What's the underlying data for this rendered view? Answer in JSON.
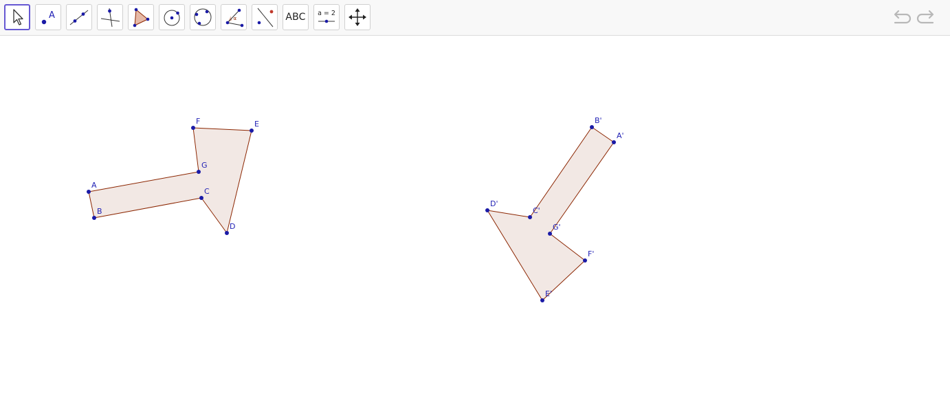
{
  "toolbar": {
    "tools": [
      {
        "id": "move",
        "icon": "arrow-pointer-icon",
        "active": true
      },
      {
        "id": "point",
        "icon": "point-icon",
        "label": "A"
      },
      {
        "id": "line",
        "icon": "line-through-points-icon"
      },
      {
        "id": "perpendicular",
        "icon": "perpendicular-line-icon"
      },
      {
        "id": "polygon",
        "icon": "polygon-icon"
      },
      {
        "id": "circle-center-point",
        "icon": "circle-center-point-icon"
      },
      {
        "id": "circle-three-points",
        "icon": "circle-three-points-icon"
      },
      {
        "id": "angle",
        "icon": "angle-icon",
        "label": "α"
      },
      {
        "id": "reflect",
        "icon": "reflect-about-line-icon"
      },
      {
        "id": "text",
        "icon": "text-tool-icon",
        "label": "ABC"
      },
      {
        "id": "slider",
        "icon": "slider-icon",
        "label": "a = 2"
      },
      {
        "id": "move-graphics",
        "icon": "move-graphics-view-icon"
      }
    ],
    "undo": {
      "icon": "undo-icon"
    },
    "redo": {
      "icon": "redo-icon"
    }
  },
  "colors": {
    "accent": "#6557d2",
    "polygon_fill": "#f2e8e4",
    "polygon_stroke": "#8b2500",
    "point_fill": "#1a1aa6",
    "label": "#1f1fb4"
  },
  "polygon_original": {
    "points": [
      {
        "name": "A"
      },
      {
        "name": "B"
      },
      {
        "name": "C"
      },
      {
        "name": "D"
      },
      {
        "name": "E"
      },
      {
        "name": "F"
      },
      {
        "name": "G"
      }
    ]
  },
  "polygon_image": {
    "points": [
      {
        "name": "A'"
      },
      {
        "name": "B'"
      },
      {
        "name": "C'"
      },
      {
        "name": "D'"
      },
      {
        "name": "E'"
      },
      {
        "name": "F'"
      },
      {
        "name": "G'"
      }
    ]
  }
}
